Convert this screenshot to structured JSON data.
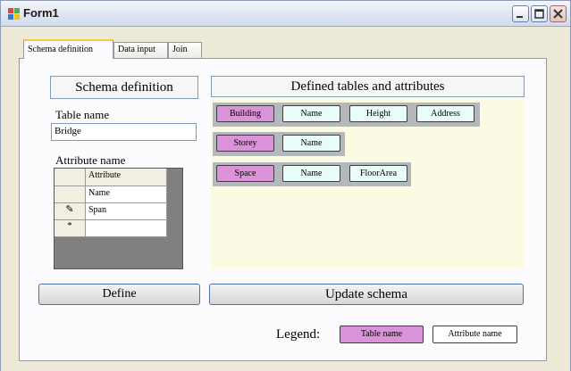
{
  "window": {
    "title": "Form1",
    "icon": "form-app-icon"
  },
  "tabs": [
    {
      "label": "Schema definition",
      "active": true
    },
    {
      "label": "Data input",
      "active": false
    },
    {
      "label": "Join",
      "active": false
    }
  ],
  "schema": {
    "header": "Schema definition",
    "table_name_label": "Table name",
    "table_name_value": "Bridge",
    "attribute_name_label": "Attribute name",
    "grid": {
      "column_header": "Attribute",
      "rows": [
        {
          "marker": "",
          "value": "Name"
        },
        {
          "marker": "✎",
          "value": "Span"
        },
        {
          "marker": "*",
          "value": ""
        }
      ]
    },
    "define_button": "Define"
  },
  "defined": {
    "header": "Defined tables and attributes",
    "tables": [
      {
        "name": "Building",
        "attributes": [
          "Name",
          "Height",
          "Address"
        ]
      },
      {
        "name": "Storey",
        "attributes": [
          "Name"
        ]
      },
      {
        "name": "Space",
        "attributes": [
          "Name",
          "FloorArea"
        ]
      }
    ],
    "update_button": "Update schema"
  },
  "legend": {
    "label": "Legend:",
    "table_name": "Table name",
    "attribute_name": "Attribute name"
  },
  "colors": {
    "table_chip": "#da92d8",
    "attribute_chip": "#e8fcf8",
    "panel_background": "#fbfbe3"
  }
}
